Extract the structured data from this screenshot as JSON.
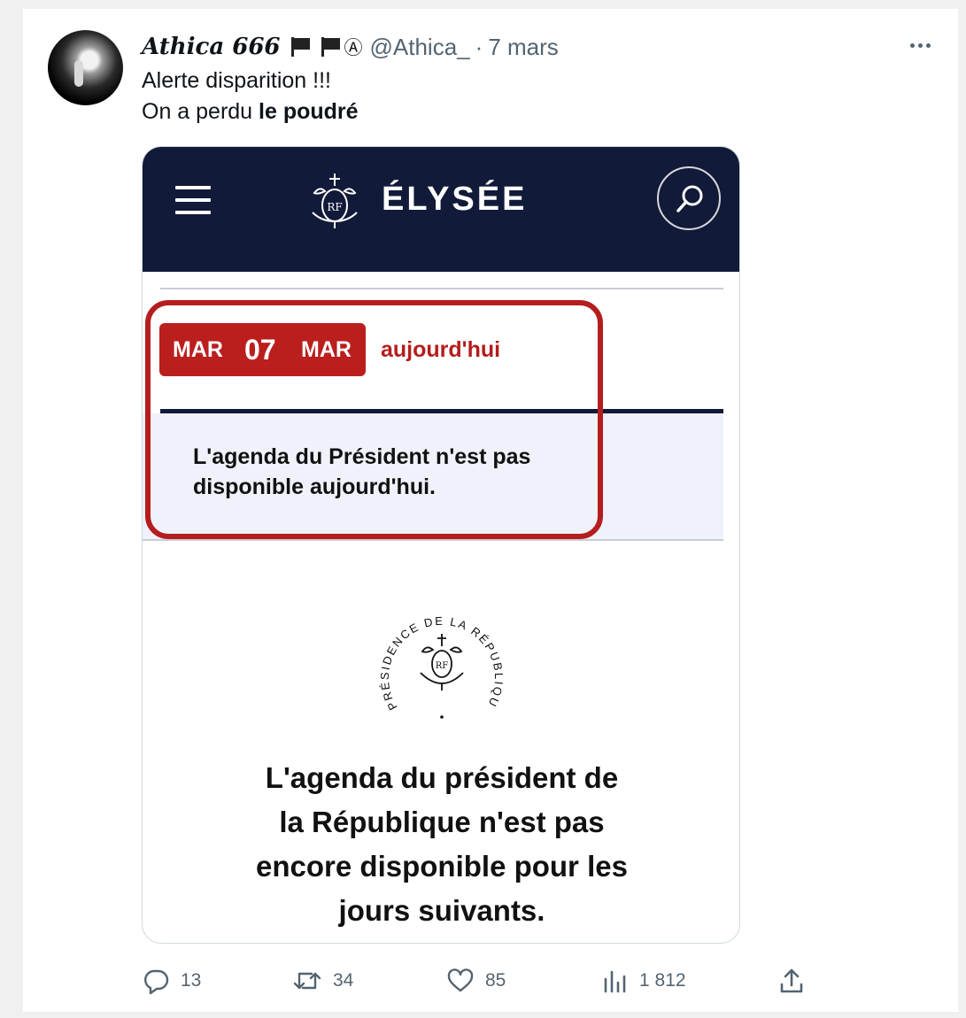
{
  "tweet": {
    "display_name": "Athica 666",
    "anarchy_symbol": "Ⓐ",
    "handle": "@Athica_",
    "separator": "·",
    "time": "7 mars",
    "text_line1": "Alerte disparition !!!",
    "text_line2_prefix": "On a perdu ",
    "text_line2_bold": "le poudré"
  },
  "image": {
    "site_name": "ÉLYSÉE",
    "date_day": "MAR",
    "date_num": "07",
    "date_month": "MAR",
    "today_label": "aujourd'hui",
    "unavailable_line1": "L'agenda du Président n'est pas",
    "unavailable_line2": "disponible aujourd'hui.",
    "seal_text": "PRÉSIDENCE DE LA RÉPUBLIQUE",
    "bottom_line1": "L'agenda du président de",
    "bottom_line2": "la République n'est pas",
    "bottom_line3": "encore disponible pour les",
    "bottom_line4": "jours suivants.",
    "colors": {
      "navy": "#111a39",
      "red": "#ba1f1e"
    }
  },
  "actions": {
    "replies": "13",
    "retweets": "34",
    "likes": "85",
    "views": "1 812"
  },
  "icons": [
    "more-icon",
    "menu-icon",
    "search-icon",
    "reply-icon",
    "retweet-icon",
    "like-icon",
    "views-icon",
    "share-icon"
  ]
}
